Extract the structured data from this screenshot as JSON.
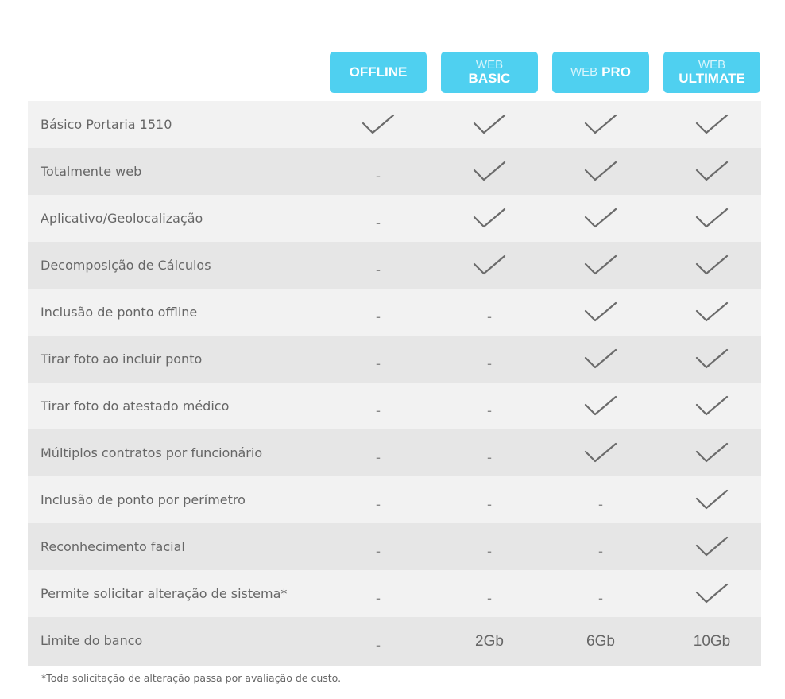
{
  "plans": [
    {
      "pre": "",
      "main": "OFFLINE"
    },
    {
      "pre": "WEB",
      "main": "BASIC"
    },
    {
      "pre": "WEB",
      "main": "PRO"
    },
    {
      "pre": "WEB",
      "main": "ULTIMATE"
    }
  ],
  "features": [
    {
      "label": "Básico Portaria 1510",
      "values": [
        "check",
        "check",
        "check",
        "check"
      ]
    },
    {
      "label": "Totalmente web",
      "values": [
        "-",
        "check",
        "check",
        "check"
      ]
    },
    {
      "label": "Aplicativo/Geolocalização",
      "values": [
        "-",
        "check",
        "check",
        "check"
      ]
    },
    {
      "label": "Decomposição de Cálculos",
      "values": [
        "-",
        "check",
        "check",
        "check"
      ]
    },
    {
      "label": "Inclusão de ponto offline",
      "values": [
        "-",
        "-",
        "check",
        "check"
      ]
    },
    {
      "label": "Tirar foto ao incluir ponto",
      "values": [
        "-",
        "-",
        "check",
        "check"
      ]
    },
    {
      "label": "Tirar foto do atestado médico",
      "values": [
        "-",
        "-",
        "check",
        "check"
      ]
    },
    {
      "label": "Múltiplos contratos por funcionário",
      "values": [
        "-",
        "-",
        "check",
        "check"
      ]
    },
    {
      "label": "Inclusão de ponto por perímetro",
      "values": [
        "-",
        "-",
        "-",
        "check"
      ]
    },
    {
      "label": "Reconhecimento facial",
      "values": [
        "-",
        "-",
        "-",
        "check"
      ]
    },
    {
      "label": "Permite solicitar alteração de sistema*",
      "values": [
        "-",
        "-",
        "-",
        "check"
      ]
    },
    {
      "label": "Limite do banco",
      "values": [
        "-",
        "2Gb",
        "6Gb",
        "10Gb"
      ]
    }
  ],
  "footnote": "*Toda solicitação de alteração passa por avaliação de custo.",
  "colors": {
    "accent": "#4fd0f0",
    "check": "#6b6b6b"
  }
}
